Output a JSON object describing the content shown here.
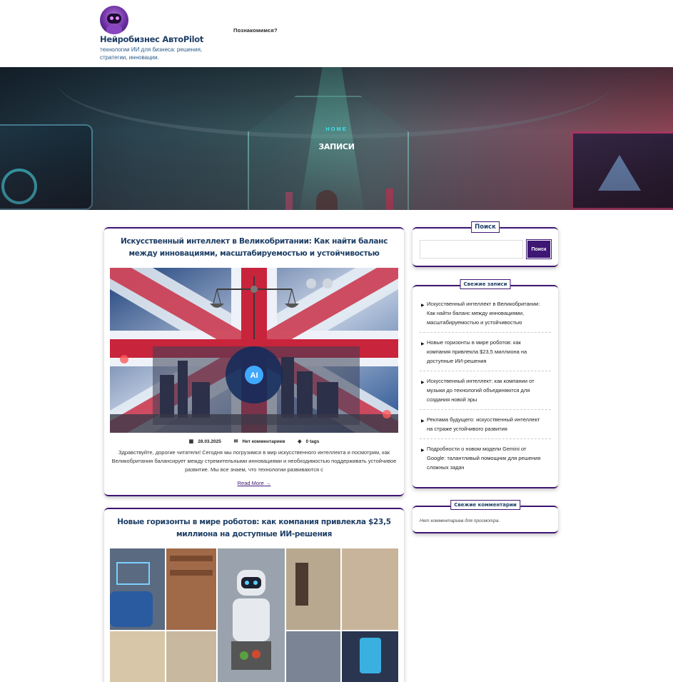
{
  "site": {
    "title": "Нейробизнес АвтоPilot",
    "description": "технологии ИИ для бизнеса: решения, стратегии, инновации."
  },
  "nav": {
    "items": [
      {
        "label": "Познакомимся?"
      }
    ]
  },
  "hero": {
    "breadcrumb": "HOME",
    "title": "ЗАПИСИ"
  },
  "posts": [
    {
      "title": "Искусственный интеллект в Великобритании: Как найти баланс между инновациями, масштабируемостью и устойчивостью",
      "date": "28.03.2025",
      "comments": "Нет комментариев",
      "tags": "0 tags",
      "excerpt": "Здравствуйте, дорогие читатели! Сегодня мы погрузимся в мир искусственного интеллекта и посмотрим, как Великобритания балансирует между стремительными инновациями и необходимостью поддерживать устойчивое развитие. Мы все знаем, что технологии развиваются с",
      "read_more": "Read More",
      "image_text": "AI"
    },
    {
      "title": "Новые горизонты в мире роботов: как компания привлекла $23,5 миллиона на доступные ИИ-решения"
    }
  ],
  "sidebar": {
    "search": {
      "label": "Поиск",
      "button": "Поиск",
      "placeholder": ""
    },
    "recent": {
      "label": "Свежие записи",
      "items": [
        "Искусственный интеллект в Великобритании: Как найти баланс между инновациями, масштабируемостью и устойчивостью",
        "Новые горизонты в мире роботов: как компания привлекла $23,5 миллиона на доступные ИИ-решения",
        "Искусственный интеллект: как компании от музыки до технологий объединяются для создания новой эры",
        "Реклама будущего: искусственный интеллект на страже устойчивого развития",
        "Подробности о новом модели Gemini от Google: талантливый помощник для решения сложных задач"
      ]
    },
    "comments": {
      "label": "Свежие комментарии",
      "empty": "Нет комментариев для просмотра."
    }
  },
  "colors": {
    "accent": "#3e1673",
    "title": "#1f3f66",
    "breadcrumb": "#3fe0f0"
  },
  "icons": {
    "meta_date": "calendar-icon",
    "meta_comments": "comments-icon",
    "meta_tags": "tags-icon",
    "read_more": "arrow-right-icon",
    "list_bullet": "caret-right-icon"
  }
}
